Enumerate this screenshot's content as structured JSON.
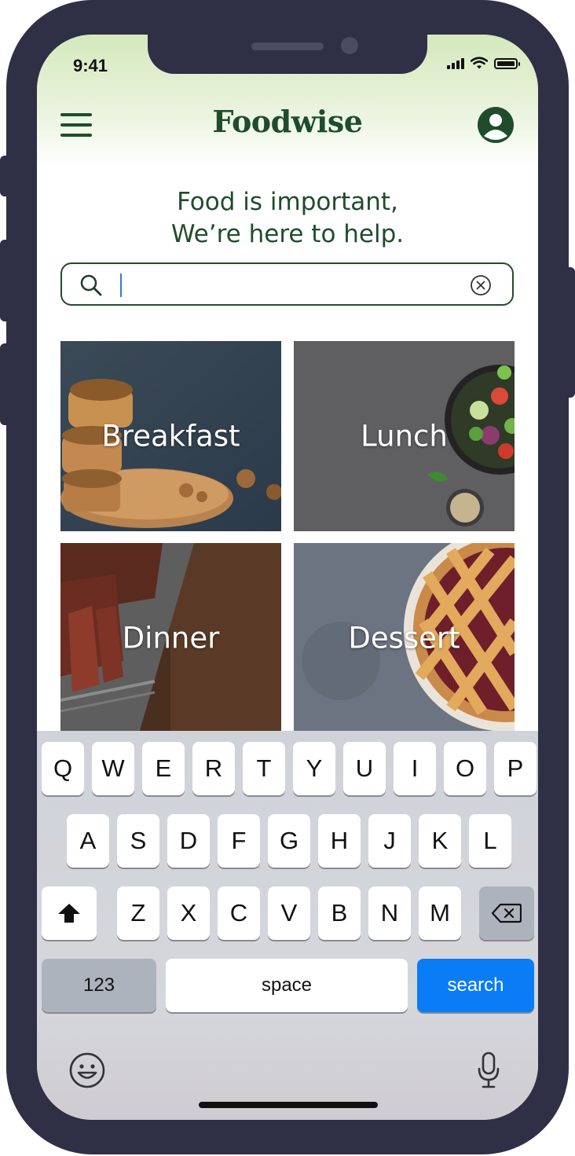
{
  "status_bar": {
    "time": "9:41"
  },
  "header": {
    "brand": "Foodwise",
    "menu_icon": "hamburger-menu-icon",
    "profile_icon": "user-profile-icon"
  },
  "hero": {
    "line1": "Food is important,",
    "line2": "We’re here to help."
  },
  "search": {
    "value": "",
    "placeholder": ""
  },
  "categories": [
    {
      "label": "Breakfast"
    },
    {
      "label": "Lunch"
    },
    {
      "label": "Dinner"
    },
    {
      "label": "Dessert"
    }
  ],
  "keyboard": {
    "row1": [
      "Q",
      "W",
      "E",
      "R",
      "T",
      "Y",
      "U",
      "I",
      "O",
      "P"
    ],
    "row2": [
      "A",
      "S",
      "D",
      "F",
      "G",
      "H",
      "J",
      "K",
      "L"
    ],
    "row3": [
      "Z",
      "X",
      "C",
      "V",
      "B",
      "N",
      "M"
    ],
    "numbers_label": "123",
    "space_label": "space",
    "search_label": "search",
    "accent_color": "#0a7cf6"
  },
  "colors": {
    "brand_green": "#1f4d2c",
    "frame": "#2f2f45"
  }
}
